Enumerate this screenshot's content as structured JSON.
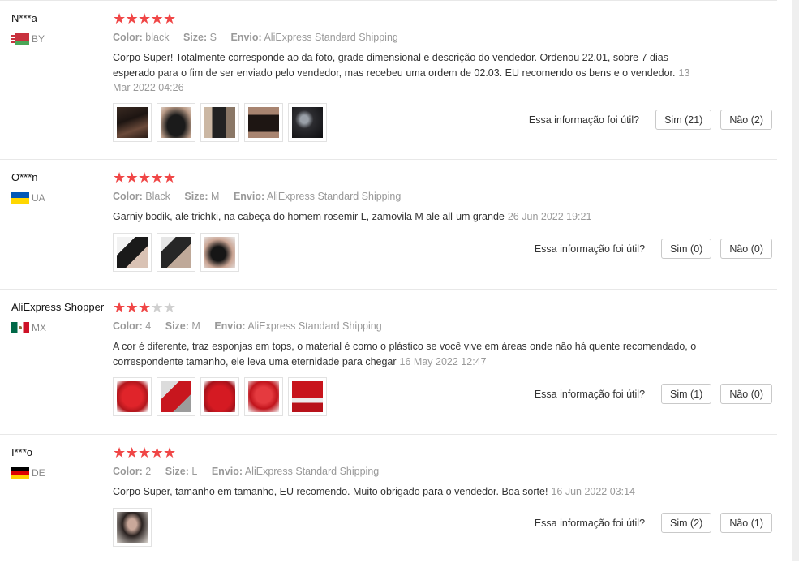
{
  "helpful_question": "Essa informação foi útil?",
  "labels": {
    "color": "Color:",
    "size": "Size:",
    "shipping": "Envio:"
  },
  "reviews": [
    {
      "user": "N***a",
      "country": "BY",
      "stars": 5,
      "stars_max": 5,
      "color": "black",
      "size": "S",
      "shipping": "AliExpress Standard Shipping",
      "text": "Corpo Super! Totalmente corresponde ao da foto, grade dimensional e descrição do vendedor. Ordenou 22.01, sobre 7 dias esperado para o fim de ser enviado pelo vendedor, mas recebeu uma ordem de 02.03. EU recomendo os bens e o vendedor.",
      "date": "13 Mar 2022 04:26",
      "photo_count": 5,
      "yes_label": "Sim (21)",
      "no_label": "Não (2)"
    },
    {
      "user": "O***n",
      "country": "UA",
      "stars": 5,
      "stars_max": 5,
      "color": "Black",
      "size": "M",
      "shipping": "AliExpress Standard Shipping",
      "text": "Garniy bodik, ale trichki, na cabeça do homem rosemir L, zamovila M ale all-um grande",
      "date": "26 Jun 2022 19:21",
      "photo_count": 3,
      "yes_label": "Sim (0)",
      "no_label": "Não (0)"
    },
    {
      "user": "AliExpress Shopper",
      "country": "MX",
      "stars": 3,
      "stars_max": 5,
      "color": "4",
      "size": "M",
      "shipping": "AliExpress Standard Shipping",
      "text": "A cor é diferente, traz esponjas em tops, o material é como o plástico se você vive em áreas onde não há quente recomendado, o correspondente tamanho, ele leva uma eternidade para chegar",
      "date": "16 May 2022 12:47",
      "photo_count": 5,
      "yes_label": "Sim (1)",
      "no_label": "Não (0)"
    },
    {
      "user": "I***o",
      "country": "DE",
      "stars": 5,
      "stars_max": 5,
      "color": "2",
      "size": "L",
      "shipping": "AliExpress Standard Shipping",
      "text": "Corpo Super, tamanho em tamanho, EU recomendo. Muito obrigado para o vendedor. Boa sorte!",
      "date": "16 Jun 2022 03:14",
      "photo_count": 1,
      "yes_label": "Sim (2)",
      "no_label": "Não (1)"
    }
  ]
}
